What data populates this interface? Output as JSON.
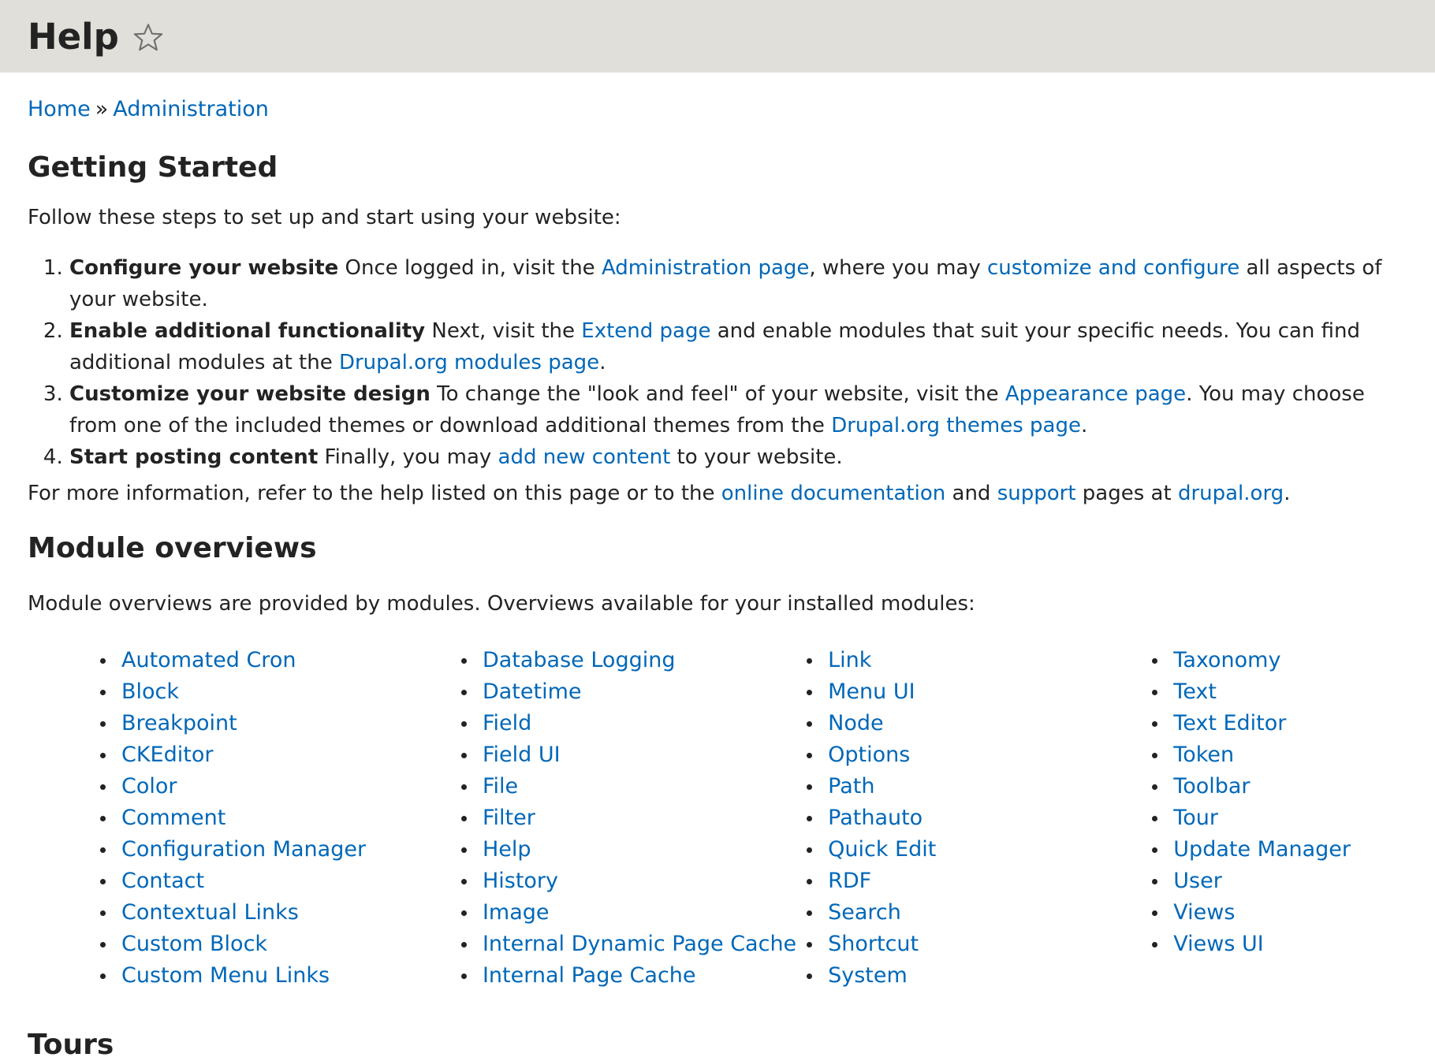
{
  "header": {
    "title": "Help",
    "star_icon": "star-outline-icon"
  },
  "breadcrumb": {
    "home": "Home",
    "separator": "»",
    "administration": "Administration"
  },
  "getting_started": {
    "heading": "Getting Started",
    "intro": "Follow these steps to set up and start using your website:",
    "steps": [
      {
        "title": "Configure your website",
        "t1": " Once logged in, visit the ",
        "l1": "Administration page",
        "t2": ", where you may ",
        "l2": "customize and configure",
        "t3": " all aspects of your website."
      },
      {
        "title": "Enable additional functionality",
        "t1": " Next, visit the ",
        "l1": "Extend page",
        "t2": " and enable modules that suit your specific needs. You can find additional modules at the ",
        "l2": "Drupal.org modules page",
        "t3": "."
      },
      {
        "title": "Customize your website design",
        "t1": " To change the \"look and feel\" of your website, visit the ",
        "l1": "Appearance page",
        "t2": ". You may choose from one of the included themes or download additional themes from the ",
        "l2": "Drupal.org themes page",
        "t3": "."
      },
      {
        "title": "Start posting content",
        "t1": " Finally, you may ",
        "l1": "add new content",
        "t2": " to your website."
      }
    ],
    "more": {
      "t1": "For more information, refer to the help listed on this page or to the ",
      "l1": "online documentation",
      "t2": " and ",
      "l2": "support",
      "t3": " pages at ",
      "l3": "drupal.org",
      "t4": "."
    }
  },
  "module_overviews": {
    "heading": "Module overviews",
    "description": "Module overviews are provided by modules. Overviews available for your installed modules:",
    "columns": [
      [
        "Automated Cron",
        "Block",
        "Breakpoint",
        "CKEditor",
        "Color",
        "Comment",
        "Configuration Manager",
        "Contact",
        "Contextual Links",
        "Custom Block",
        "Custom Menu Links"
      ],
      [
        "Database Logging",
        "Datetime",
        "Field",
        "Field UI",
        "File",
        "Filter",
        "Help",
        "History",
        "Image",
        "Internal Dynamic Page Cache",
        "Internal Page Cache"
      ],
      [
        "Link",
        "Menu UI",
        "Node",
        "Options",
        "Path",
        "Pathauto",
        "Quick Edit",
        "RDF",
        "Search",
        "Shortcut",
        "System"
      ],
      [
        "Taxonomy",
        "Text",
        "Text Editor",
        "Token",
        "Toolbar",
        "Tour",
        "Update Manager",
        "User",
        "Views",
        "Views UI"
      ]
    ]
  },
  "tours": {
    "heading": "Tours"
  }
}
